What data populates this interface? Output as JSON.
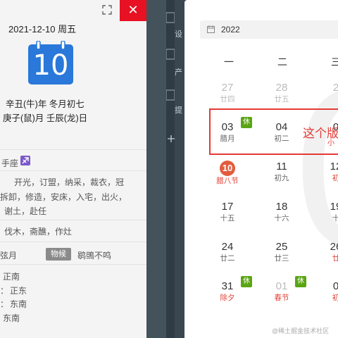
{
  "left_panel": {
    "close_glyph": "✕",
    "date": "2021-12-10 周五",
    "calendar_icon_day": "10",
    "lunar_year_line": "辛丑(牛)年 冬月初七",
    "lunar_month_line": "庚子(鼠)月 壬辰(龙)日",
    "constellation": "手座",
    "yi_lines": [
      "开光，订盟，纳采，裁衣，冠",
      "拆卸，修造，安床，入宅，出火，",
      "谢土，赴任"
    ],
    "ji_line": "伐木，斋醮，作灶",
    "moon_phase": "弦月",
    "wuhou_badge": "物候",
    "wuhou_text": "鹖鴠不鸣",
    "directions": [
      "正南",
      "正东",
      "东南",
      "东南"
    ],
    "direction_prefixes": [
      "",
      "：",
      "：",
      ""
    ]
  },
  "desktop_strip": {
    "labels": [
      "设",
      "产",
      "提"
    ]
  },
  "calendar": {
    "year_select": "2022",
    "weekdays": [
      "一",
      "二",
      "三"
    ],
    "rows": [
      [
        {
          "d": "27",
          "l": "廿四",
          "style": "dim"
        },
        {
          "d": "28",
          "l": "廿五",
          "style": "dim"
        },
        {
          "d": "2",
          "l": "",
          "style": "dim"
        }
      ],
      [
        {
          "d": "03",
          "l": "腊月",
          "style": "normal"
        },
        {
          "d": "04",
          "l": "初二",
          "style": "normal"
        },
        {
          "d": "0",
          "l": "",
          "style": "normal"
        }
      ],
      [
        {
          "d": "10",
          "l": "腊八节",
          "style": "today"
        },
        {
          "d": "11",
          "l": "初九",
          "style": "normal"
        },
        {
          "d": "12",
          "l": "初",
          "style": "red"
        }
      ],
      [
        {
          "d": "17",
          "l": "十五",
          "style": "normal"
        },
        {
          "d": "18",
          "l": "十六",
          "style": "normal"
        },
        {
          "d": "19",
          "l": "十",
          "style": "normal"
        }
      ],
      [
        {
          "d": "24",
          "l": "廿二",
          "style": "normal"
        },
        {
          "d": "25",
          "l": "廿三",
          "style": "normal"
        },
        {
          "d": "26",
          "l": "廿",
          "style": "red"
        }
      ],
      [
        {
          "d": "31",
          "l": "除夕",
          "style": "red"
        },
        {
          "d": "01",
          "l": "春节",
          "style": "red-dim"
        },
        {
          "d": "0",
          "l": "初",
          "style": "red"
        }
      ]
    ],
    "rest_label": "休",
    "watermark": "0",
    "annotation": "这个版",
    "annotation_small": "小",
    "credit": "@稀土掘金技术社区"
  },
  "colors": {
    "accent_blue": "#2a78d9",
    "close_red": "#e81123",
    "rest_green": "#5aa514",
    "highlight_red": "#e53935"
  }
}
